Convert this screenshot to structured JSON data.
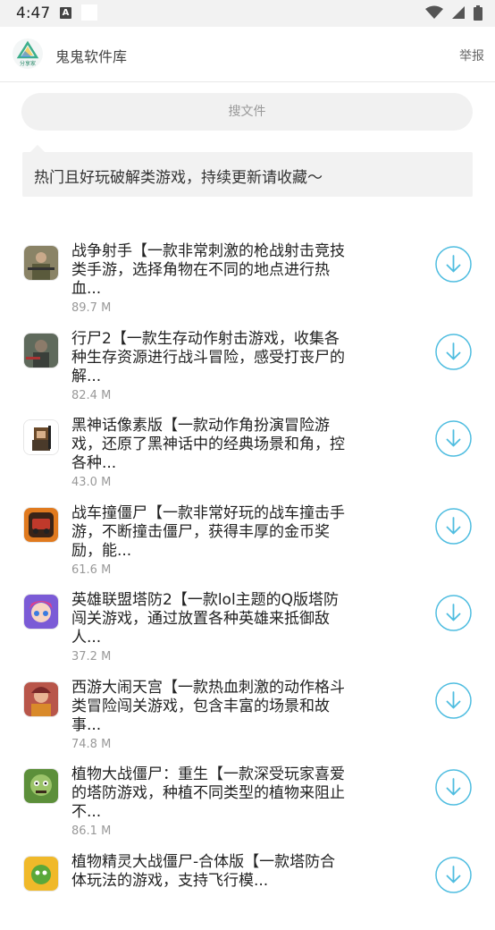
{
  "status_bar": {
    "time": "4:47",
    "notification_letter": "A",
    "icons": [
      "wifi-icon",
      "signal-icon",
      "battery-icon"
    ]
  },
  "header": {
    "logo_caption": "分享家",
    "title": "鬼鬼软件库",
    "report_label": "举报"
  },
  "search": {
    "placeholder": "搜文件"
  },
  "notice": {
    "text": "热门且好玩破解类游戏，持续更新请收藏～"
  },
  "colors": {
    "accent": "#4fbde0",
    "background": "#ffffff",
    "panel": "#f2f2f2"
  },
  "files": [
    {
      "title": "战争射手【一款非常刺激的枪战射击竞技类手游，选择角物在不同的地点进行热血...",
      "size": "89.7 M",
      "icon": "soldier-icon"
    },
    {
      "title": "行尸2【一款生存动作射击游戏，收集各种生存资源进行战斗冒险，感受打丧尸的解...",
      "size": "82.4 M",
      "icon": "zombie-survivor-icon"
    },
    {
      "title": "黑神话像素版【一款动作角扮演冒险游戏，还原了黑神话中的经典场景和角，控各种...",
      "size": "43.0 M",
      "icon": "pixel-monkey-icon"
    },
    {
      "title": "战车撞僵尸【一款非常好玩的战车撞击手游，不断撞击僵尸，获得丰厚的金币奖励，能...",
      "size": "61.6 M",
      "icon": "car-icon"
    },
    {
      "title": "英雄联盟塔防2【一款lol主题的Q版塔防闯关游戏，通过放置各种英雄来抵御敌人...",
      "size": "37.2 M",
      "icon": "hero-girl-icon"
    },
    {
      "title": "西游大闹天宫【一款热血刺激的动作格斗类冒险闯关游戏，包含丰富的场景和故事...",
      "size": "74.8 M",
      "icon": "warrior-icon"
    },
    {
      "title": "植物大战僵尸：重生【一款深受玩家喜爱的塔防游戏，种植不同类型的植物来阻止不...",
      "size": "86.1 M",
      "icon": "zombie-icon"
    },
    {
      "title": "植物精灵大战僵尸-合体版【一款塔防合体玩法的游戏，支持飞行模...",
      "size": "",
      "icon": "plant-icon"
    }
  ]
}
